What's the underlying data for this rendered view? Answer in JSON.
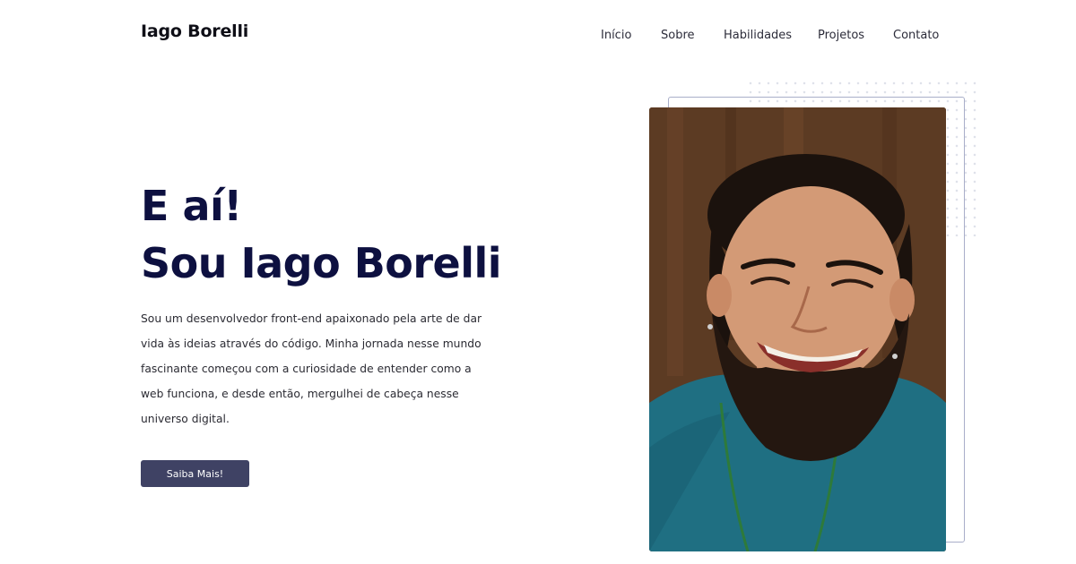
{
  "header": {
    "logo": "Iago Borelli",
    "nav": [
      "Início",
      "Sobre",
      "Habilidades",
      "Projetos",
      "Contato"
    ]
  },
  "hero": {
    "greeting": "E aí!",
    "name_line": "Sou Iago Borelli",
    "bio": "Sou um desenvolvedor front-end apaixonado pela arte de dar vida às ideias através do código. Minha jornada nesse mundo fascinante começou com a curiosidade de entender como a web funciona, e desde então, mergulhei de cabeça nesse universo digital.",
    "cta_label": "Saiba Mais!"
  },
  "colors": {
    "heading": "#0d1040",
    "button": "#3f4264",
    "frame": "#a9aec9"
  }
}
